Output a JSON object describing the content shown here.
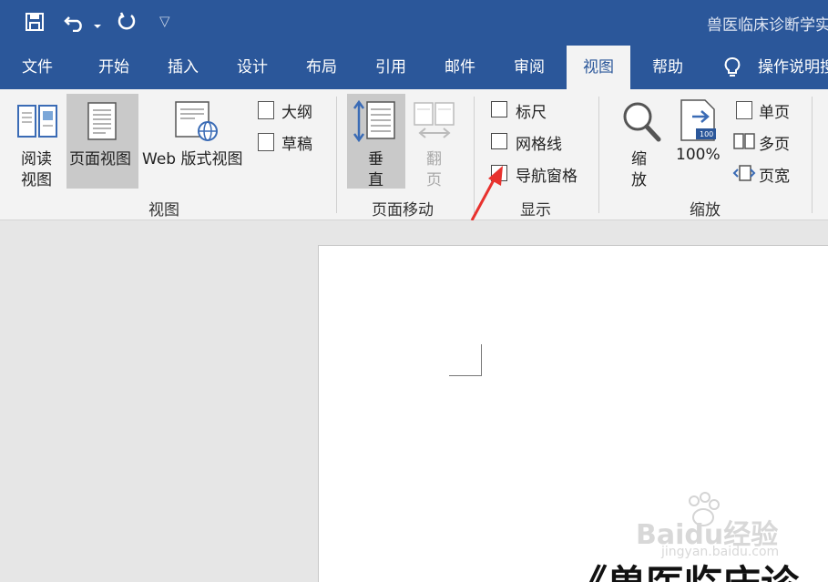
{
  "quick_access": {
    "more": "▽"
  },
  "document_title": "兽医临床诊断学实",
  "tabs": [
    {
      "label": "文件"
    },
    {
      "label": "开始"
    },
    {
      "label": "插入"
    },
    {
      "label": "设计"
    },
    {
      "label": "布局"
    },
    {
      "label": "引用"
    },
    {
      "label": "邮件"
    },
    {
      "label": "审阅"
    },
    {
      "label": "视图"
    },
    {
      "label": "帮助"
    },
    {
      "label": "操作说明搜"
    }
  ],
  "ribbon": {
    "views": {
      "read_line1": "阅读",
      "read_line2": "视图",
      "print_layout": "页面视图",
      "web_layout": "Web 版式视图",
      "outline": "大纲",
      "draft": "草稿",
      "group": "视图"
    },
    "page_movement": {
      "vertical_line1": "垂",
      "vertical_line2": "直",
      "side_line1": "翻",
      "side_line2": "页",
      "group": "页面移动"
    },
    "show": {
      "ruler": "标尺",
      "gridlines": "网格线",
      "nav_pane": "导航窗格",
      "group": "显示"
    },
    "zoom": {
      "zoom_line1": "缩",
      "zoom_line2": "放",
      "hundred": "100%",
      "badge": "100",
      "one_page": "单页",
      "multi_page": "多页",
      "page_width": "页宽",
      "group": "缩放"
    }
  },
  "document": {
    "heading_partial": "《兽医临床诊"
  },
  "watermark": {
    "brand": "Baidu经验",
    "url": "jingyan.baidu.com"
  },
  "colors": {
    "accent": "#2b579a",
    "ribbon_bg": "#f3f3f3",
    "arrow": "#e8322e"
  }
}
